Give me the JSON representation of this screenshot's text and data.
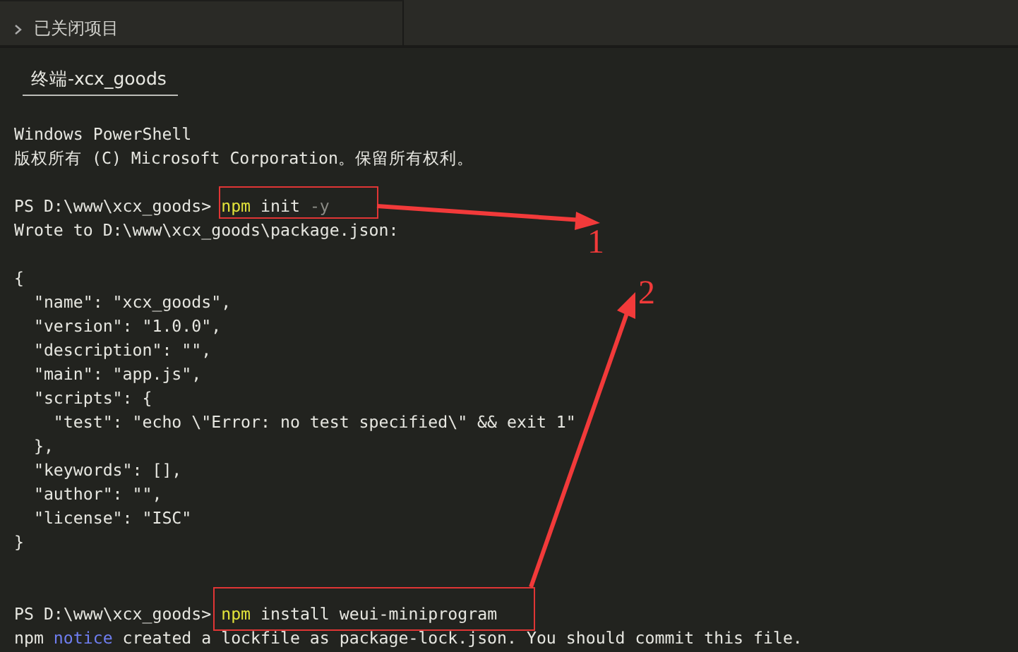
{
  "explorer": {
    "section": {
      "label": "已关闭项目",
      "expanded": false
    }
  },
  "terminal": {
    "tab": {
      "label": "终端-xcx_goods",
      "selected": true
    },
    "lines": [
      {
        "kind": "text",
        "segments": [
          {
            "text": "Windows PowerShell",
            "kind": "plain"
          }
        ]
      },
      {
        "kind": "text",
        "segments": [
          {
            "text": "版权所有 (C) Microsoft Corporation。保留所有权利。",
            "kind": "plain"
          }
        ]
      },
      {
        "kind": "blank"
      },
      {
        "kind": "text",
        "segments": [
          {
            "text": "PS D:\\www\\xcx_goods> ",
            "kind": "plain"
          },
          {
            "text": "npm",
            "kind": "command"
          },
          {
            "text": " init ",
            "kind": "plain"
          },
          {
            "text": "-y",
            "kind": "flag"
          }
        ]
      },
      {
        "kind": "text",
        "segments": [
          {
            "text": "Wrote to D:\\www\\xcx_goods\\package.json:",
            "kind": "plain"
          }
        ]
      },
      {
        "kind": "blank"
      },
      {
        "kind": "text",
        "segments": [
          {
            "text": "{",
            "kind": "plain"
          }
        ]
      },
      {
        "kind": "text",
        "segments": [
          {
            "text": "  \"name\": \"xcx_goods\",",
            "kind": "plain"
          }
        ]
      },
      {
        "kind": "text",
        "segments": [
          {
            "text": "  \"version\": \"1.0.0\",",
            "kind": "plain"
          }
        ]
      },
      {
        "kind": "text",
        "segments": [
          {
            "text": "  \"description\": \"\",",
            "kind": "plain"
          }
        ]
      },
      {
        "kind": "text",
        "segments": [
          {
            "text": "  \"main\": \"app.js\",",
            "kind": "plain"
          }
        ]
      },
      {
        "kind": "text",
        "segments": [
          {
            "text": "  \"scripts\": {",
            "kind": "plain"
          }
        ]
      },
      {
        "kind": "text",
        "segments": [
          {
            "text": "    \"test\": \"echo \\\"Error: no test specified\\\" && exit 1\"",
            "kind": "plain"
          }
        ]
      },
      {
        "kind": "text",
        "segments": [
          {
            "text": "  },",
            "kind": "plain"
          }
        ]
      },
      {
        "kind": "text",
        "segments": [
          {
            "text": "  \"keywords\": [],",
            "kind": "plain"
          }
        ]
      },
      {
        "kind": "text",
        "segments": [
          {
            "text": "  \"author\": \"\",",
            "kind": "plain"
          }
        ]
      },
      {
        "kind": "text",
        "segments": [
          {
            "text": "  \"license\": \"ISC\"",
            "kind": "plain"
          }
        ]
      },
      {
        "kind": "text",
        "segments": [
          {
            "text": "}",
            "kind": "plain"
          }
        ]
      },
      {
        "kind": "blank"
      },
      {
        "kind": "blank"
      },
      {
        "kind": "text",
        "segments": [
          {
            "text": "PS D:\\www\\xcx_goods> ",
            "kind": "plain"
          },
          {
            "text": "npm",
            "kind": "command"
          },
          {
            "text": " install weui-miniprogram",
            "kind": "plain"
          }
        ]
      },
      {
        "kind": "text",
        "segments": [
          {
            "text": "npm ",
            "kind": "plain"
          },
          {
            "text": "notice",
            "kind": "notice"
          },
          {
            "text": " created a lockfile as package-lock.json. You should commit this file.",
            "kind": "plain"
          }
        ]
      }
    ]
  },
  "annotations": [
    {
      "label": "1"
    },
    {
      "label": "2"
    }
  ]
}
